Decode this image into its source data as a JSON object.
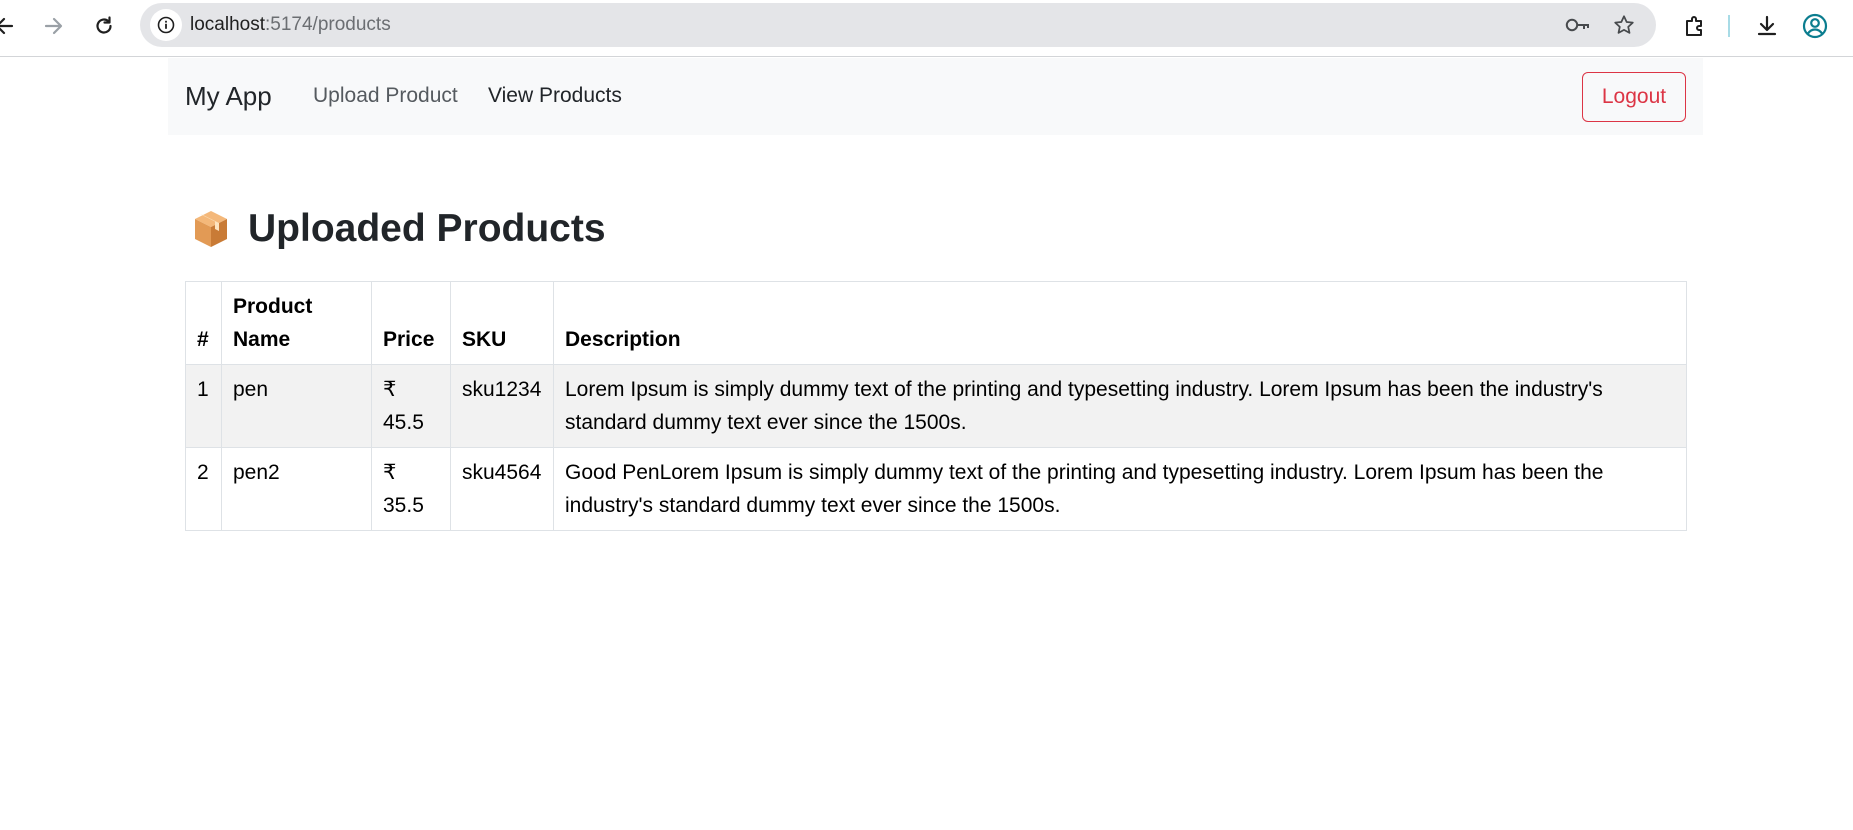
{
  "browser": {
    "url_host": "localhost",
    "url_path": ":5174/products",
    "icons": {
      "back": "arrow-left-icon",
      "forward": "arrow-right-icon",
      "reload": "reload-icon",
      "site_info": "info-icon",
      "password": "key-icon",
      "bookmark": "star-icon",
      "extensions": "puzzle-icon",
      "downloads": "download-icon",
      "profile": "profile-icon"
    }
  },
  "navbar": {
    "brand": "My App",
    "links": [
      "Upload Product",
      "View Products"
    ],
    "logout_label": "Logout",
    "logout_color": "#dc3545"
  },
  "main": {
    "title": "Uploaded Products",
    "title_icon": "package-icon",
    "table": {
      "headers": {
        "num": "#",
        "name": "Product Name",
        "price": "Price",
        "sku": "SKU",
        "description": "Description"
      },
      "rows": [
        {
          "num": "1",
          "name": "pen",
          "price": "₹ 45.5",
          "sku": "sku1234",
          "description": "Lorem Ipsum is simply dummy text of the printing and typesetting industry. Lorem Ipsum has been the industry's standard dummy text ever since the 1500s."
        },
        {
          "num": "2",
          "name": "pen2",
          "price": "₹ 35.5",
          "sku": "sku4564",
          "description": "Good PenLorem Ipsum is simply dummy text of the printing and typesetting industry. Lorem Ipsum has been the industry's standard dummy text ever since the 1500s."
        }
      ]
    }
  }
}
